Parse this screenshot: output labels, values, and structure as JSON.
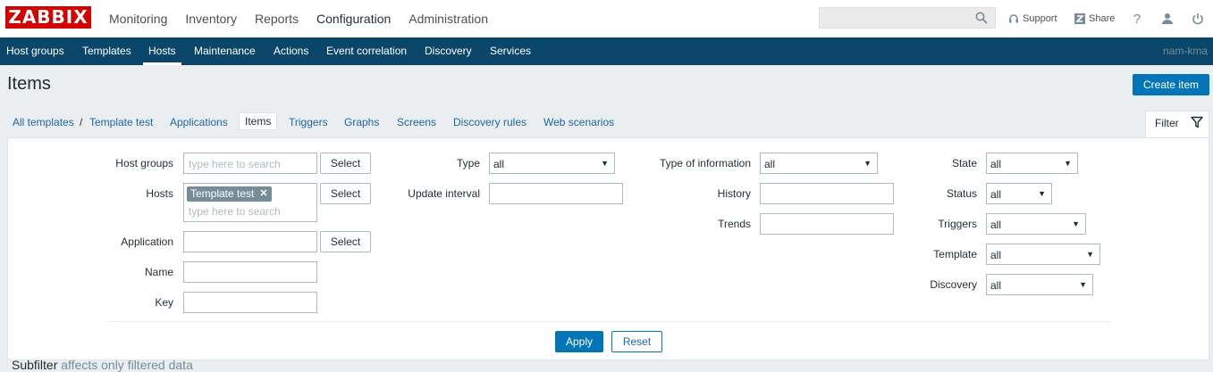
{
  "header": {
    "logo": "ZABBIX",
    "menu": [
      "Monitoring",
      "Inventory",
      "Reports",
      "Configuration",
      "Administration"
    ],
    "active_menu": "Configuration",
    "search_placeholder": "",
    "support": "Support",
    "share": "Share",
    "help": "?"
  },
  "subnav": {
    "items": [
      "Host groups",
      "Templates",
      "Hosts",
      "Maintenance",
      "Actions",
      "Event correlation",
      "Discovery",
      "Services"
    ],
    "active": "Hosts",
    "user": "nam-kma"
  },
  "page": {
    "title": "Items",
    "create_button": "Create item"
  },
  "breadcrumbs": {
    "all_templates": "All templates",
    "separator": "/",
    "template": "Template test",
    "tabs": [
      "Applications",
      "Items",
      "Triggers",
      "Graphs",
      "Screens",
      "Discovery rules",
      "Web scenarios"
    ],
    "selected": "Items"
  },
  "filter": {
    "tab_label": "Filter",
    "host_groups_label": "Host groups",
    "host_groups_placeholder": "type here to search",
    "hosts_label": "Hosts",
    "hosts_tag": "Template test",
    "hosts_placeholder": "type here to search",
    "application_label": "Application",
    "name_label": "Name",
    "key_label": "Key",
    "select_label": "Select",
    "type_label": "Type",
    "type_value": "all",
    "update_interval_label": "Update interval",
    "type_of_information_label": "Type of information",
    "type_of_information_value": "all",
    "history_label": "History",
    "trends_label": "Trends",
    "state_label": "State",
    "state_value": "all",
    "status_label": "Status",
    "status_value": "all",
    "triggers_label": "Triggers",
    "triggers_value": "all",
    "template_label": "Template",
    "template_value": "all",
    "discovery_label": "Discovery",
    "discovery_value": "all",
    "apply": "Apply",
    "reset": "Reset"
  },
  "subfilter": {
    "title": "Subfilter",
    "note": "affects only filtered data"
  },
  "colors": {
    "brand": "#d40000",
    "nav": "#0a466a",
    "primary": "#0275b8",
    "link": "#1f65a6"
  }
}
